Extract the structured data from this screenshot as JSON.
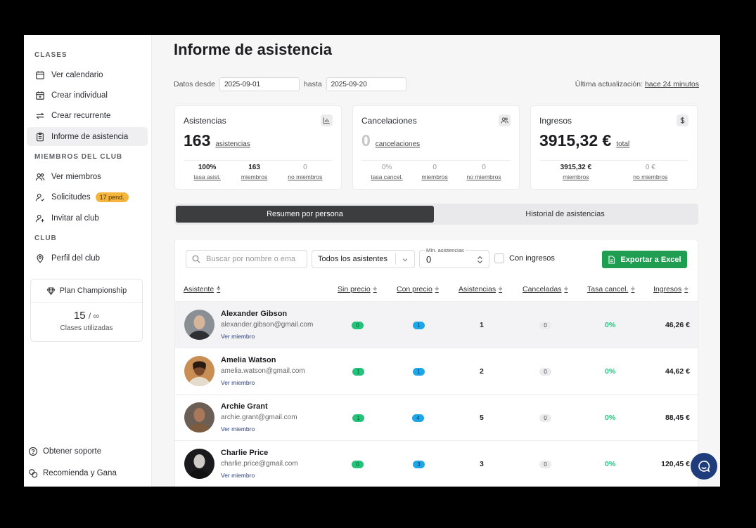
{
  "sidebar": {
    "section_classes": "CLASES",
    "ver_calendario": "Ver calendario",
    "crear_individual": "Crear individual",
    "crear_recurrente": "Crear recurrente",
    "informe_asistencia": "Informe de asistencia",
    "section_miembros": "MIEMBROS DEL CLUB",
    "ver_miembros": "Ver miembros",
    "solicitudes": "Solicitudes",
    "solicitudes_badge": "17 pend.",
    "invitar": "Invitar al club",
    "section_club": "CLUB",
    "perfil": "Perfil del club",
    "plan_name": "Plan Championship",
    "plan_used": "15",
    "plan_limit": "/ ∞",
    "plan_label": "Clases utilizadas",
    "soporte": "Obtener soporte",
    "recomienda": "Recomienda y Gana"
  },
  "header": {
    "title": "Informe de asistencia",
    "from_label": "Datos desde",
    "from_date": "2025-09-01",
    "to_label": "hasta",
    "to_date": "2025-09-20",
    "last_update_label": "Última actualización:",
    "last_update_value": "hace 24 minutos"
  },
  "stats": {
    "asistencias": {
      "title": "Asistencias",
      "value": "163",
      "unit": "asistencias",
      "subs": [
        {
          "v": "100%",
          "l": "tasa asist."
        },
        {
          "v": "163",
          "l": "miembros"
        },
        {
          "v": "0",
          "l": "no miembros"
        }
      ]
    },
    "cancelaciones": {
      "title": "Cancelaciones",
      "value": "0",
      "unit": "cancelaciones",
      "subs": [
        {
          "v": "0%",
          "l": "tasa cancel."
        },
        {
          "v": "0",
          "l": "miembros"
        },
        {
          "v": "0",
          "l": "no miembros"
        }
      ]
    },
    "ingresos": {
      "title": "Ingresos",
      "value": "3915,32 €",
      "unit": "total",
      "subs": [
        {
          "v": "3915,32 €",
          "l": "miembros"
        },
        {
          "v": "0 €",
          "l": "no miembros"
        }
      ]
    }
  },
  "tabs": {
    "resumen": "Resumen por persona",
    "historial": "Historial de asistencias"
  },
  "toolbar": {
    "search_placeholder": "Buscar por nombre o ema",
    "filter_value": "Todos los asistentes",
    "min_label": "Mín. asistencias",
    "min_value": "0",
    "con_ingresos": "Con ingresos",
    "export": "Exportar a Excel"
  },
  "table": {
    "headers": {
      "asistente": "Asistente",
      "sin_precio": "Sin precio",
      "con_precio": "Con precio",
      "asistencias": "Asistencias",
      "canceladas": "Canceladas",
      "tasa_cancel": "Tasa cancel.",
      "ingresos": "Ingresos"
    },
    "rows": [
      {
        "name": "Alexander Gibson",
        "email": "alexander.gibson@gmail.com",
        "link": "Ver miembro",
        "sin_precio": "0",
        "con_precio": "1",
        "asistencias": "1",
        "canceladas": "0",
        "tasa": "0%",
        "ingresos": "46,26 €"
      },
      {
        "name": "Amelia Watson",
        "email": "amelia.watson@gmail.com",
        "link": "Ver miembro",
        "sin_precio": "1",
        "con_precio": "1",
        "asistencias": "2",
        "canceladas": "0",
        "tasa": "0%",
        "ingresos": "44,62 €"
      },
      {
        "name": "Archie Grant",
        "email": "archie.grant@gmail.com",
        "link": "Ver miembro",
        "sin_precio": "1",
        "con_precio": "4",
        "asistencias": "5",
        "canceladas": "0",
        "tasa": "0%",
        "ingresos": "88,45 €"
      },
      {
        "name": "Charlie Price",
        "email": "charlie.price@gmail.com",
        "link": "Ver miembro",
        "sin_precio": "0",
        "con_precio": "3",
        "asistencias": "3",
        "canceladas": "0",
        "tasa": "0%",
        "ingresos": "120,45 €"
      }
    ]
  },
  "colors": {
    "accent_green": "#1f9d51",
    "pill_green": "#24c27a",
    "pill_blue": "#1fa6e6",
    "badge_orange": "#f5b53c",
    "chat_blue": "#1f3d7d"
  }
}
